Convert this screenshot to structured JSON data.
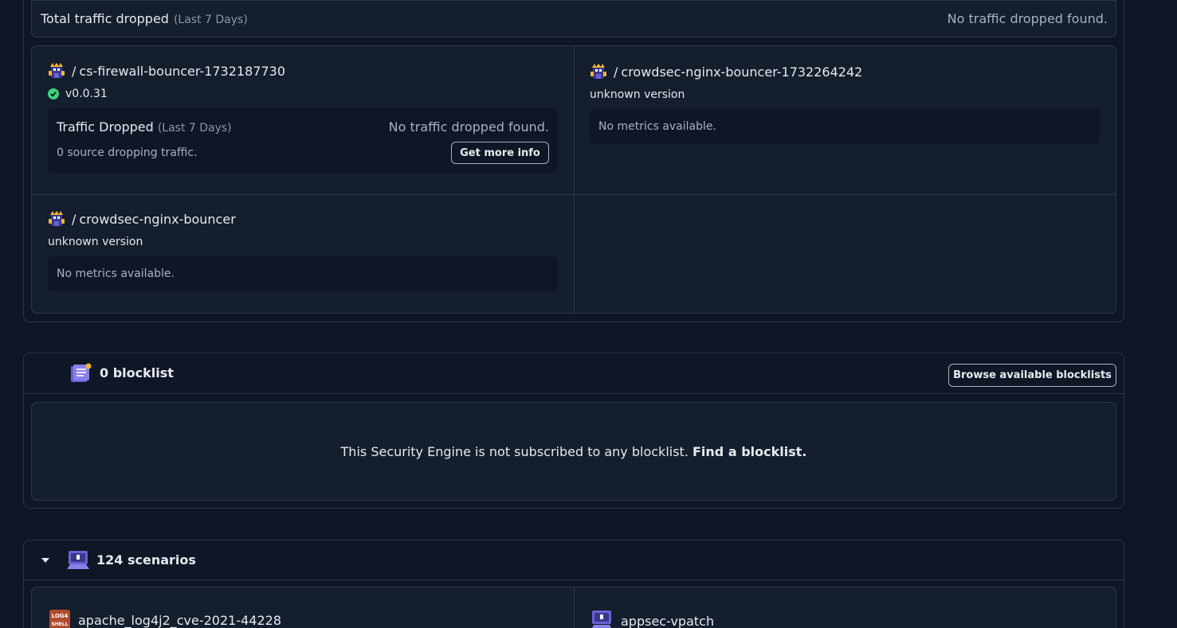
{
  "traffic_summary": {
    "title": "Total traffic dropped",
    "period": "(Last 7 Days)",
    "status": "No traffic dropped found."
  },
  "bouncers": [
    {
      "slash": "/",
      "name": "cs-firewall-bouncer-1732187730",
      "version": "v0.0.31",
      "version_ok": true,
      "traffic_title": "Traffic Dropped",
      "traffic_period": "(Last 7 Days)",
      "traffic_status": "No traffic dropped found.",
      "sources_text": "0 source dropping traffic.",
      "more_info_label": "Get more info"
    },
    {
      "slash": "/",
      "name": "crowdsec-nginx-bouncer-1732264242",
      "version": "unknown version",
      "metrics_text": "No metrics available."
    },
    {
      "slash": "/",
      "name": "crowdsec-nginx-bouncer",
      "version": "unknown version",
      "metrics_text": "No metrics available."
    }
  ],
  "blocklist": {
    "count_label": "0 blocklist",
    "browse_label": "Browse available blocklists",
    "empty_text": "This Security Engine is not subscribed to any blocklist.",
    "find_link": "Find a blocklist."
  },
  "scenarios": {
    "count_label": "124 scenarios",
    "items": [
      {
        "name": "apache_log4j2_cve-2021-44228",
        "icon": "log4shell-icon",
        "icon_text_1": "LOG4",
        "icon_text_2": "SHELL"
      },
      {
        "name": "appsec-vpatch",
        "icon": "appsec-icon"
      }
    ]
  },
  "colors": {
    "background": "#0f1626",
    "panel": "#141e2d",
    "inner": "#0f1727",
    "border": "#2b3647",
    "success": "#3fd17f",
    "accent_purple": "#6b5fd6",
    "accent_yellow": "#f2b53a"
  }
}
